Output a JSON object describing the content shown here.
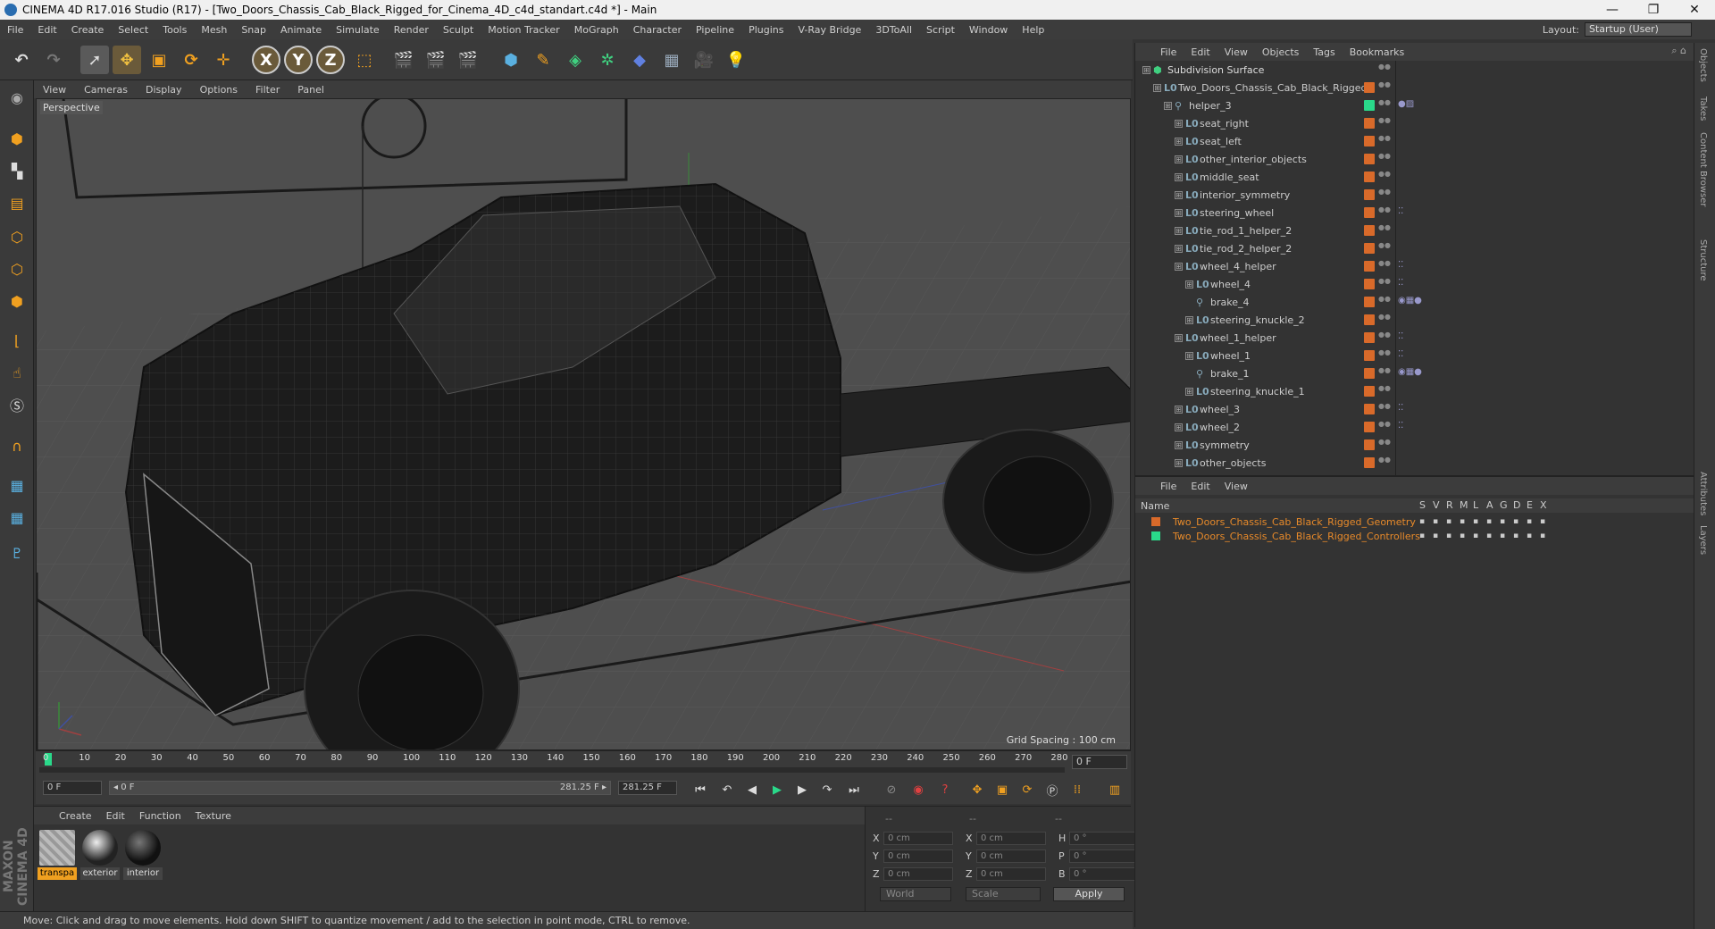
{
  "window": {
    "title": "CINEMA 4D R17.016 Studio (R17) - [Two_Doors_Chassis_Cab_Black_Rigged_for_Cinema_4D_c4d_standart.c4d *] - Main",
    "minimize": "—",
    "restore": "❐",
    "close": "✕"
  },
  "menu": [
    "File",
    "Edit",
    "Create",
    "Select",
    "Tools",
    "Mesh",
    "Snap",
    "Animate",
    "Simulate",
    "Render",
    "Sculpt",
    "Motion Tracker",
    "MoGraph",
    "Character",
    "Pipeline",
    "Plugins",
    "V-Ray Bridge",
    "3DToAll",
    "Script",
    "Window",
    "Help"
  ],
  "layout": {
    "label": "Layout:",
    "value": "Startup (User)"
  },
  "viewport": {
    "menu": [
      "View",
      "Cameras",
      "Display",
      "Options",
      "Filter",
      "Panel"
    ],
    "label": "Perspective",
    "grid_spacing": "Grid Spacing : 100 cm"
  },
  "timeline": {
    "ticks": [
      "0",
      "10",
      "20",
      "30",
      "40",
      "50",
      "60",
      "70",
      "80",
      "90",
      "100",
      "110",
      "120",
      "130",
      "140",
      "150",
      "160",
      "170",
      "180",
      "190",
      "200",
      "210",
      "220",
      "230",
      "240",
      "250",
      "260",
      "270",
      "280"
    ],
    "current_frame": "0 F",
    "start_field": "0 F",
    "range_start": "◂ 0 F",
    "range_end": "281.25 F ▸",
    "end_field": "281.25 F"
  },
  "materials": {
    "menu": [
      "Create",
      "Edit",
      "Function",
      "Texture"
    ],
    "items": [
      {
        "name": "transpa"
      },
      {
        "name": "exterior"
      },
      {
        "name": "interior"
      }
    ]
  },
  "coords": {
    "headers": [
      "--",
      "--",
      "--"
    ],
    "rows": [
      {
        "a": "X",
        "av": "0 cm",
        "b": "X",
        "bv": "0 cm",
        "c": "H",
        "cv": "0 °"
      },
      {
        "a": "Y",
        "av": "0 cm",
        "b": "Y",
        "bv": "0 cm",
        "c": "P",
        "cv": "0 °"
      },
      {
        "a": "Z",
        "av": "0 cm",
        "b": "Z",
        "bv": "0 cm",
        "c": "B",
        "cv": "0 °"
      }
    ],
    "world": "World",
    "scale": "Scale",
    "apply": "Apply"
  },
  "status": "Move: Click and drag to move elements. Hold down SHIFT to quantize movement / add to the selection in point mode, CTRL to remove.",
  "maxon": "MAXON CINEMA 4D",
  "objects": {
    "menu": [
      "File",
      "Edit",
      "View",
      "Objects",
      "Tags",
      "Bookmarks"
    ],
    "rows": [
      {
        "name": "Subdivision Surface",
        "indent": 0,
        "icon": "⬢",
        "tag": "none"
      },
      {
        "name": "Two_Doors_Chassis_Cab_Black_Rigged",
        "indent": 1,
        "icon": "L0",
        "tag": "orange"
      },
      {
        "name": "helper_3",
        "indent": 2,
        "icon": "⚲",
        "tag": "green"
      },
      {
        "name": "seat_right",
        "indent": 3,
        "icon": "L0",
        "tag": "orange"
      },
      {
        "name": "seat_left",
        "indent": 3,
        "icon": "L0",
        "tag": "orange"
      },
      {
        "name": "other_interior_objects",
        "indent": 3,
        "icon": "L0",
        "tag": "orange"
      },
      {
        "name": "middle_seat",
        "indent": 3,
        "icon": "L0",
        "tag": "orange"
      },
      {
        "name": "interior_symmetry",
        "indent": 3,
        "icon": "L0",
        "tag": "orange"
      },
      {
        "name": "steering_wheel",
        "indent": 3,
        "icon": "L0",
        "tag": "orange"
      },
      {
        "name": "tie_rod_1_helper_2",
        "indent": 3,
        "icon": "L0",
        "tag": "orange"
      },
      {
        "name": "tie_rod_2_helper_2",
        "indent": 3,
        "icon": "L0",
        "tag": "orange"
      },
      {
        "name": "wheel_4_helper",
        "indent": 3,
        "icon": "L0",
        "tag": "orange"
      },
      {
        "name": "wheel_4",
        "indent": 4,
        "icon": "L0",
        "tag": "orange"
      },
      {
        "name": "brake_4",
        "indent": 4,
        "icon": "⚲",
        "tag": "orange"
      },
      {
        "name": "steering_knuckle_2",
        "indent": 4,
        "icon": "L0",
        "tag": "orange"
      },
      {
        "name": "wheel_1_helper",
        "indent": 3,
        "icon": "L0",
        "tag": "orange"
      },
      {
        "name": "wheel_1",
        "indent": 4,
        "icon": "L0",
        "tag": "orange"
      },
      {
        "name": "brake_1",
        "indent": 4,
        "icon": "⚲",
        "tag": "orange"
      },
      {
        "name": "steering_knuckle_1",
        "indent": 4,
        "icon": "L0",
        "tag": "orange"
      },
      {
        "name": "wheel_3",
        "indent": 3,
        "icon": "L0",
        "tag": "orange"
      },
      {
        "name": "wheel_2",
        "indent": 3,
        "icon": "L0",
        "tag": "orange"
      },
      {
        "name": "symmetry",
        "indent": 3,
        "icon": "L0",
        "tag": "orange"
      },
      {
        "name": "other_objects",
        "indent": 3,
        "icon": "L0",
        "tag": "orange"
      }
    ]
  },
  "layers": {
    "menu": [
      "File",
      "Edit",
      "View"
    ],
    "header_name": "Name",
    "header_cols": [
      "S",
      "V",
      "R",
      "M",
      "L",
      "A",
      "G",
      "D",
      "E",
      "X"
    ],
    "rows": [
      {
        "name": "Two_Doors_Chassis_Cab_Black_Rigged_Geometry",
        "color": "#d96a2a"
      },
      {
        "name": "Two_Doors_Chassis_Cab_Black_Rigged_Controllers",
        "color": "#2ad98a"
      }
    ]
  },
  "sidetabs": [
    "Objects",
    "Takes",
    "Content Browser",
    "Structure",
    "Attributes",
    "Layers"
  ],
  "colors": {
    "accent_orange": "#d96a2a",
    "layer_name": "#e88a2a",
    "viewport_bg": "#4e4e4e"
  }
}
